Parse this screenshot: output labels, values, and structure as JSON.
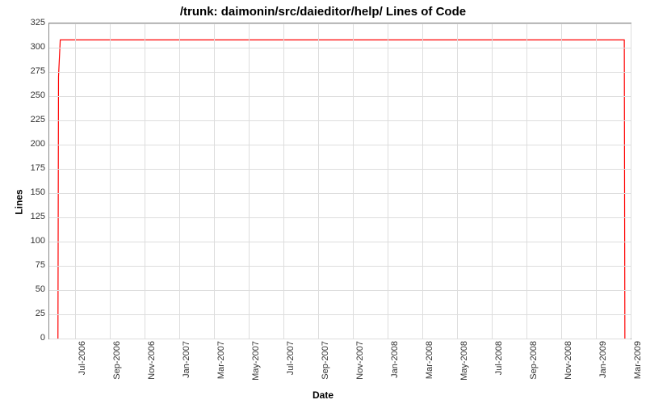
{
  "chart_data": {
    "type": "line",
    "title": "/trunk: daimonin/src/daieditor/help/ Lines of Code",
    "xlabel": "Date",
    "ylabel": "Lines",
    "ylim": [
      0,
      325
    ],
    "y_ticks": [
      0,
      25,
      50,
      75,
      100,
      125,
      150,
      175,
      200,
      225,
      250,
      275,
      300,
      325
    ],
    "x_categories": [
      "Jul-2006",
      "Sep-2006",
      "Nov-2006",
      "Jan-2007",
      "Mar-2007",
      "May-2007",
      "Jul-2007",
      "Sep-2007",
      "Nov-2007",
      "Jan-2008",
      "Mar-2008",
      "May-2008",
      "Jul-2008",
      "Sep-2008",
      "Nov-2008",
      "Jan-2009",
      "Mar-2009"
    ],
    "series": [
      {
        "name": "Lines of Code",
        "color": "#ff0000",
        "points": [
          {
            "x": "2006-06-01",
            "y": 0
          },
          {
            "x": "2006-06-02",
            "y": 270
          },
          {
            "x": "2006-06-05",
            "y": 308
          },
          {
            "x": "2009-02-20",
            "y": 308
          },
          {
            "x": "2009-02-21",
            "y": 0
          }
        ]
      }
    ]
  }
}
